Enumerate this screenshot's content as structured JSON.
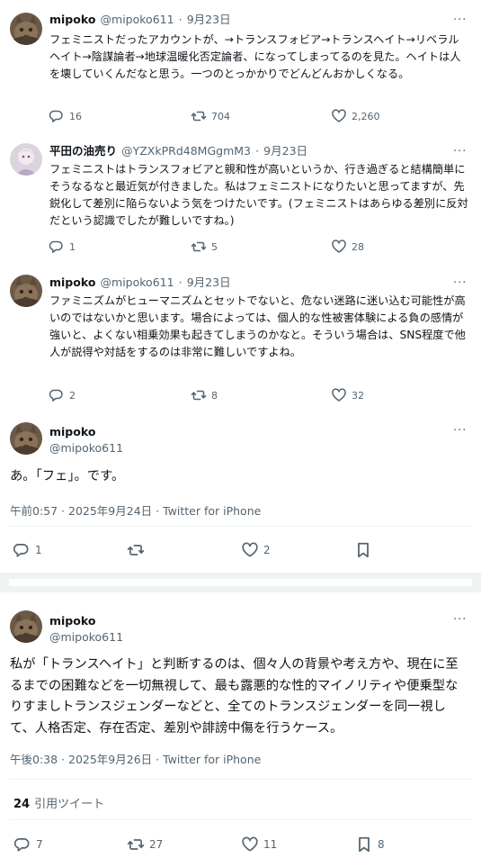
{
  "tweets": [
    {
      "name": "mipoko",
      "handle": "@mipoko611",
      "sep": "·",
      "date": "9月23日",
      "text": "フェミニストだったアカウントが、→トランスフォビア→トランスヘイト→リベラルヘイト→陰謀論者→地球温暖化否定論者、になってしまってるのを見た。ヘイトは人を壊していくんだなと思う。一つのとっかかりでどんどんおかしくなる。",
      "replies": "16",
      "retweets": "704",
      "likes": "2,260"
    },
    {
      "name": "平田の油売り",
      "handle": "@YZXkPRd48MGgmM3",
      "sep": "·",
      "date": "9月23日",
      "text": "フェミニストはトランスフォビアと親和性が高いというか、行き過ぎると結構簡単にそうなるなと最近気が付きました。私はフェミニストになりたいと思ってますが、先鋭化して差別に陥らないよう気をつけたいです。(フェミニストはあらゆる差別に反対だという認識でしたが難しいですね。)",
      "replies": "1",
      "retweets": "5",
      "likes": "28"
    },
    {
      "name": "mipoko",
      "handle": "@mipoko611",
      "sep": "·",
      "date": "9月23日",
      "text": "ファミニズムがヒューマニズムとセットでないと、危ない迷路に迷い込む可能性が高いのではないかと思います。場合によっては、個人的な性被害体験による負の感情が強いと、よくない相乗効果も起きてしまうのかなと。そういう場合は、SNS程度で他人が説得や対話をするのは非常に難しいですよね。",
      "replies": "2",
      "retweets": "8",
      "likes": "32"
    }
  ],
  "focus1": {
    "name": "mipoko",
    "handle": "@mipoko611",
    "text": "あ。「フェ」。です。",
    "meta": "午前0:57 · 2025年9月24日 · Twitter for iPhone",
    "replies": "1",
    "likes": "2"
  },
  "focus2": {
    "name": "mipoko",
    "handle": "@mipoko611",
    "text": "私が「トランスヘイト」と判断するのは、個々人の背景や考え方や、現在に至るまでの困難などを一切無視して、最も露悪的な性的マイノリティや便乗型なりすましトランスジェンダーなどと、全てのトランスジェンダーを同一視して、人格否定、存在否定、差別や誹謗中傷を行うケース。",
    "meta": "午後0:38 · 2025年9月26日 · Twitter for iPhone",
    "quote_count": "24",
    "quote_label": "引用ツイート",
    "replies": "7",
    "retweets": "27",
    "likes": "11",
    "bookmarks": "8"
  },
  "more_glyph": "···",
  "colors": {
    "text": "#0f1419",
    "muted": "#536471",
    "line": "#eff3f4"
  }
}
